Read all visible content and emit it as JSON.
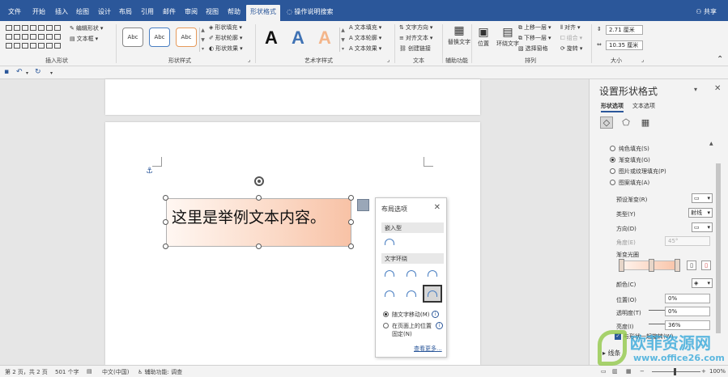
{
  "tabs": [
    {
      "label": "文件"
    },
    {
      "label": "开始"
    },
    {
      "label": "插入"
    },
    {
      "label": "绘图"
    },
    {
      "label": "设计"
    },
    {
      "label": "布局"
    },
    {
      "label": "引用"
    },
    {
      "label": "邮件"
    },
    {
      "label": "审阅"
    },
    {
      "label": "视图"
    },
    {
      "label": "帮助"
    },
    {
      "label": "形状格式"
    }
  ],
  "tell_me": "操作说明搜索",
  "share": "共享",
  "ribbon": {
    "insert_shapes": {
      "edit_shape": "编辑形状",
      "textbox": "文本框",
      "label": "插入形状"
    },
    "shape_styles": {
      "style_text": "Abc",
      "fill": "形状填充",
      "outline": "形状轮廓",
      "effects": "形状效果",
      "label": "形状样式"
    },
    "wordart": {
      "letter": "A",
      "text_fill": "文本填充",
      "text_outline": "文本轮廓",
      "text_effects": "文本效果",
      "label": "艺术字样式"
    },
    "text": {
      "direction": "文字方向",
      "align": "对齐文本",
      "link": "创建链接",
      "label": "文本"
    },
    "accessibility": {
      "alt_text": "替换文字",
      "label": "辅助功能"
    },
    "arrange": {
      "position": "位置",
      "wrap": "环绕文字",
      "forward": "上移一层",
      "backward": "下移一层",
      "selection": "选择窗格",
      "align": "对齐",
      "group": "组合",
      "rotate": "旋转",
      "label": "排列"
    },
    "size": {
      "height": "2.71 厘米",
      "width": "10.35 厘米",
      "label": "大小"
    }
  },
  "document": {
    "textbox_text": "这里是举例文本内容。"
  },
  "layout_popup": {
    "title": "布局选项",
    "inline_label": "嵌入型",
    "wrap_label": "文字环绕",
    "move_with_text": "随文字移动(M)",
    "fix_position_1": "在页面上的位置",
    "fix_position_2": "固定(N)",
    "see_more": "查看更多..."
  },
  "format_pane": {
    "title": "设置形状格式",
    "tab_shape": "形状选项",
    "tab_text": "文本选项",
    "fill_options": [
      {
        "label": "纯色填充(S)",
        "checked": false
      },
      {
        "label": "渐变填充(G)",
        "checked": true
      },
      {
        "label": "图片或纹理填充(P)",
        "checked": false
      },
      {
        "label": "图案填充(A)",
        "checked": false
      }
    ],
    "preset": "预设渐变(R)",
    "type": "类型(Y)",
    "type_value": "射线",
    "direction": "方向(D)",
    "angle": "角度(E)",
    "angle_value": "45°",
    "gradient_stops": "渐变光圈",
    "color": "颜色(C)",
    "position": "位置(O)",
    "position_value": "0%",
    "transparency": "透明度(T)",
    "transparency_value": "0%",
    "brightness": "亮度(I)",
    "brightness_value": "36%",
    "rotate_with_shape": "与形状一起旋转(W)",
    "line_section": "线条"
  },
  "status": {
    "page": "第 2 页，共 2 页",
    "words": "501 个字",
    "language": "中文(中国)",
    "accessibility": "辅助功能: 调查",
    "zoom": "100%"
  },
  "watermark": {
    "name": "欧菲资源网",
    "url": "www.office26.com"
  },
  "colors": {
    "accent": "#2b579a",
    "gradient_start": "#fff7f2",
    "gradient_end": "#f8c2a6"
  }
}
